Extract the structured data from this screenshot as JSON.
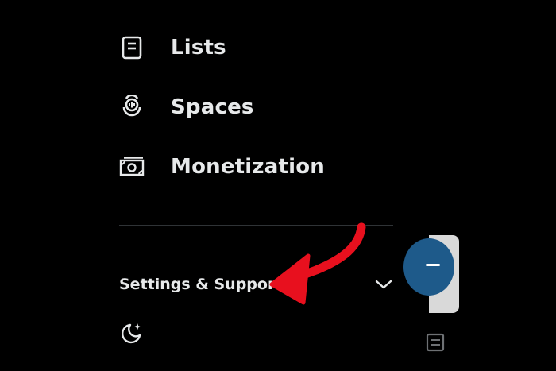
{
  "menu": {
    "items": [
      {
        "label": "Lists",
        "icon": "list-document-icon"
      },
      {
        "label": "Spaces",
        "icon": "spaces-microphone-icon"
      },
      {
        "label": "Monetization",
        "icon": "money-icon"
      }
    ]
  },
  "settings": {
    "label": "Settings & Support",
    "chevron_icon": "chevron-down-icon"
  },
  "display_toggle": {
    "icon": "moon-sparkle-icon"
  },
  "annotation": {
    "arrow_color": "#e8101e"
  },
  "colors": {
    "background": "#000000",
    "text": "#e7e9ea",
    "divider": "#2f3336"
  }
}
